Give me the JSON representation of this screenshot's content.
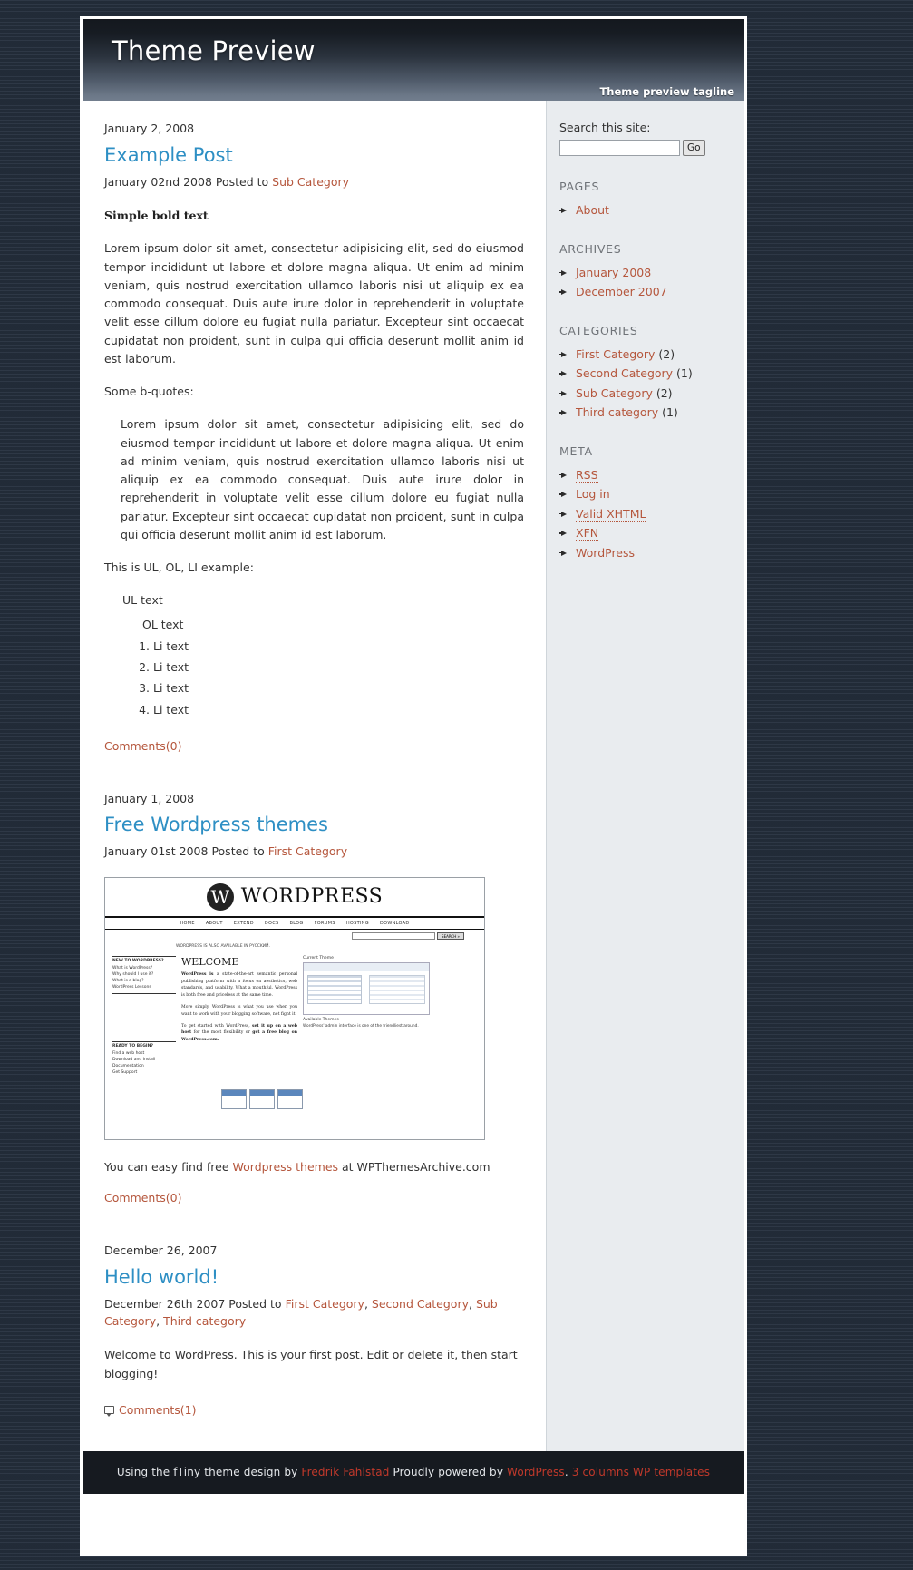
{
  "header": {
    "title": "Theme Preview",
    "tagline": "Theme preview tagline"
  },
  "posts": [
    {
      "date_heading": "January 2, 2008",
      "title": "Example Post",
      "meta_prefix": "January 02nd 2008 Posted to ",
      "categories": [
        "Sub Category"
      ],
      "bold_lead": "Simple bold text",
      "paragraph1": "Lorem ipsum dolor sit amet, consectetur adipisicing elit, sed do eiusmod tempor incididunt ut labore et dolore magna aliqua. Ut enim ad minim veniam, quis nostrud exercitation ullamco laboris nisi ut aliquip ex ea commodo consequat. Duis aute irure dolor in reprehenderit in voluptate velit esse cillum dolore eu fugiat nulla pariatur. Excepteur sint occaecat cupidatat non proident, sunt in culpa qui officia deserunt mollit anim id est laborum.",
      "quote_intro": "Some b-quotes:",
      "blockquote": "Lorem ipsum dolor sit amet, consectetur adipisicing elit, sed do eiusmod tempor incididunt ut labore et dolore magna aliqua. Ut enim ad minim veniam, quis nostrud exercitation ullamco laboris nisi ut aliquip ex ea commodo consequat. Duis aute irure dolor in reprehenderit in voluptate velit esse cillum dolore eu fugiat nulla pariatur. Excepteur sint occaecat cupidatat non proident, sunt in culpa qui officia deserunt mollit anim id est laborum.",
      "list_intro": "This is UL, OL, LI example:",
      "ul_text": "UL text",
      "ol_text": "OL text",
      "li_items": [
        "Li text",
        "Li text",
        "Li text",
        "Li text"
      ],
      "comments_label": "Comments(0)"
    },
    {
      "date_heading": "January 1, 2008",
      "title": "Free Wordpress themes",
      "meta_prefix": "January 01st 2008 Posted to ",
      "categories": [
        "First Category"
      ],
      "caption_before": "You can easy find free ",
      "caption_link": "Wordpress themes",
      "caption_after": " at WPThemesArchive.com",
      "comments_label": "Comments(0)"
    },
    {
      "date_heading": "December 26, 2007",
      "title": "Hello world!",
      "meta_prefix": "December 26th 2007 Posted to ",
      "categories": [
        "First Category",
        "Second Category",
        "Sub Category",
        "Third category"
      ],
      "body": "Welcome to WordPress. This is your first post. Edit or delete it, then start blogging!",
      "comments_label": "Comments(1)"
    }
  ],
  "wp_shot": {
    "brand": "WORDPRESS",
    "logo_letter": "W",
    "nav": [
      "HOME",
      "ABOUT",
      "EXTEND",
      "DOCS",
      "BLOG",
      "FORUMS",
      "HOSTING",
      "DOWNLOAD"
    ],
    "search_button": "SEARCH »",
    "also_line": "WORDPRESS IS ALSO AVAILABLE IN ΡΥCCΚИЙ.",
    "box1_title": "NEW TO WORDPRESS?",
    "box1_items": [
      "What is WordPress?",
      "Why should I use it?",
      "What is a blog?",
      "WordPress Lessons"
    ],
    "box2_title": "READY TO BEGIN?",
    "box2_items": [
      "Find a web host",
      "Download and Install",
      "Documentation",
      "Get Support"
    ],
    "welcome": "WELCOME",
    "para1_bold": "WordPress is",
    "para1": " a state-of-the-art semantic personal publishing platform with a focus on aesthetics, web standards, and usability. What a mouthful. WordPress is both free and priceless at the same time.",
    "para2": "More simply, WordPress is what you use when you want to work with your blogging software, not fight it.",
    "para3_before": "To get started with WordPress, ",
    "para3_bold1": "set it up on a web host",
    "para3_mid": " for the most flexibility or ",
    "para3_bold2": "get a free blog on WordPress.com.",
    "right_title": "Current Theme",
    "right_available": "Available Themes",
    "right_caption": "WordPress' admin interface is one of the friendliest around."
  },
  "sidebar": {
    "search_label": "Search this site:",
    "search_value": "",
    "search_placeholder": "",
    "go_label": "Go",
    "sections": [
      {
        "heading": "PAGES",
        "items": [
          {
            "label": "About",
            "count": "",
            "dotted": false
          }
        ]
      },
      {
        "heading": "ARCHIVES",
        "items": [
          {
            "label": "January 2008",
            "count": "",
            "dotted": false
          },
          {
            "label": "December 2007",
            "count": "",
            "dotted": false
          }
        ]
      },
      {
        "heading": "CATEGORIES",
        "items": [
          {
            "label": "First Category",
            "count": " (2)",
            "dotted": false
          },
          {
            "label": "Second Category",
            "count": " (1)",
            "dotted": false
          },
          {
            "label": "Sub Category",
            "count": " (2)",
            "dotted": false
          },
          {
            "label": "Third category",
            "count": " (1)",
            "dotted": false
          }
        ]
      },
      {
        "heading": "META",
        "items": [
          {
            "label": "RSS",
            "count": "",
            "dotted": true
          },
          {
            "label": "Log in",
            "count": "",
            "dotted": false
          },
          {
            "label": "Valid XHTML",
            "count": "",
            "dotted": true
          },
          {
            "label": "XFN",
            "count": "",
            "dotted": true
          },
          {
            "label": "WordPress",
            "count": "",
            "dotted": false
          }
        ]
      }
    ]
  },
  "footer": {
    "text_1": "Using the fTiny theme design by ",
    "link_1": "Fredrik Fahlstad",
    "text_2": " Proudly powered by ",
    "link_2": "WordPress",
    "text_3": ". ",
    "link_3": "3 columns WP templates"
  },
  "colors": {
    "accent_blue": "#2e8fc4",
    "link_red": "#b5563c",
    "sidebar_bg": "#e9ecef",
    "footer_bg": "#161a20",
    "page_bg": "#26313f"
  }
}
